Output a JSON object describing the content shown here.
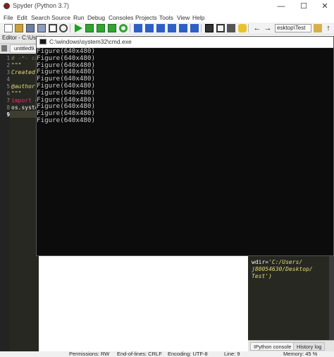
{
  "window": {
    "title": "Spyder (Python 3.7)",
    "minimize": "—",
    "maximize": "☐",
    "close": "✕"
  },
  "menu": [
    "File",
    "Edit",
    "Search",
    "Source",
    "Run",
    "Debug",
    "Consoles",
    "Projects",
    "Tools",
    "View",
    "Help"
  ],
  "toolbar": {
    "path_value": "esktop\\Test"
  },
  "editor": {
    "header": "Editor - C:\\Users\\",
    "tab": "untitled9.p",
    "line_numbers": [
      "1",
      "2",
      "3",
      "4",
      "5",
      "6",
      "7",
      "8",
      "9"
    ],
    "lines": [
      {
        "text": "# -*- co",
        "color": "#75715e"
      },
      {
        "text": "\"\"\"",
        "color": "#e6db74"
      },
      {
        "text": "Created",
        "color": "#e6db74"
      },
      {
        "text": "",
        "color": "#ffffff"
      },
      {
        "text": "@author:",
        "color": "#e6db74"
      },
      {
        "text": "\"\"\"",
        "color": "#e6db74"
      },
      {
        "text": "import o",
        "color": "#f92672"
      },
      {
        "text": "os.syste",
        "color": "#f8f8f2"
      },
      {
        "text": "",
        "color": "#ffffff"
      }
    ]
  },
  "cmd": {
    "title": "C:\\windows\\system32\\cmd.exe",
    "lines": [
      "Figure(640x480)",
      "Figure(640x480)",
      "Figure(640x480)",
      "Figure(640x480)",
      "Figure(640x480)",
      "Figure(640x480)",
      "Figure(640x480)",
      "Figure(640x480)",
      "Figure(640x480)",
      "Figure(640x480)",
      "Figure(640x480)"
    ]
  },
  "console": {
    "lines": [
      {
        "text": "wdir=",
        "color": "#f8f8f2"
      },
      {
        "text": "'C:/Users/",
        "color": "#e6db74"
      },
      {
        "text": "j80054630/Desktop/",
        "color": "#e6db74"
      },
      {
        "text": "Test')",
        "color": "#e6db74"
      }
    ],
    "tabs": [
      "IPython console",
      "History log"
    ]
  },
  "status": {
    "permissions": "Permissions: RW",
    "eol": "End-of-lines: CRLF",
    "encoding": "Encoding: UTF-8",
    "line": "Line: 9",
    "memory": "Memory: 45 %"
  }
}
